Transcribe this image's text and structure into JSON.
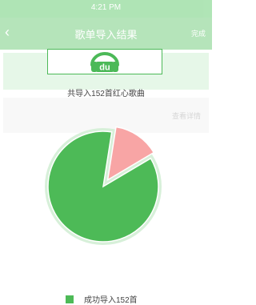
{
  "background_app": {
    "time": "4:21 PM",
    "title": "歌单导入结果",
    "right_label": "完成",
    "row_right": "查看详情"
  },
  "dialog": {
    "logo": "du",
    "subtitle": "共导入152首红心歌曲"
  },
  "chart_data": {
    "type": "pie",
    "slices": [
      {
        "label": "成功导入152首",
        "value": 86,
        "color": "#4dba57"
      },
      {
        "value": 14,
        "color": "#f8a5a5"
      }
    ],
    "legend": [
      "成功导入152首"
    ],
    "legend_position": "bottom"
  },
  "colors": {
    "accent": "#4cb958",
    "ring": "#d7f0d9",
    "success": "#4dba57",
    "fail": "#f8a5a5"
  }
}
